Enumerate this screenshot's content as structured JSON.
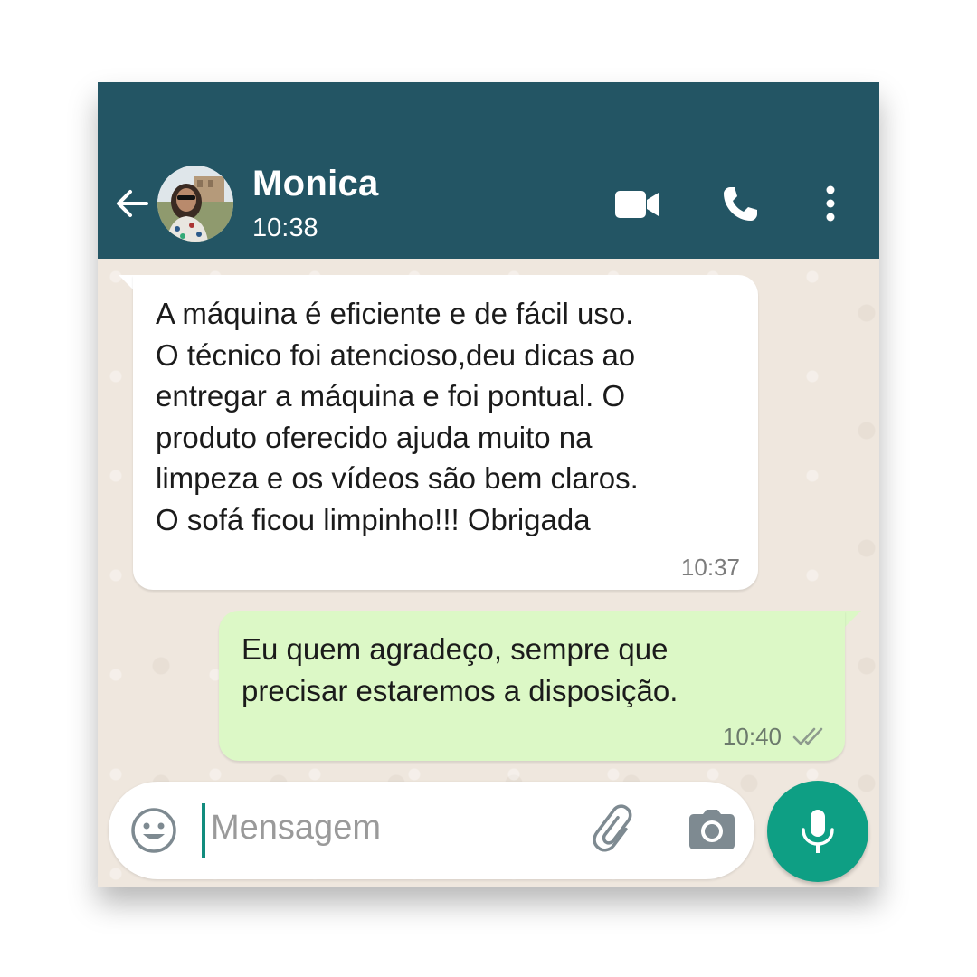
{
  "header": {
    "contact_name": "Monica",
    "last_seen": "10:38",
    "icons": [
      "back-arrow-icon",
      "video-call-icon",
      "phone-call-icon",
      "more-options-icon"
    ]
  },
  "messages": [
    {
      "direction": "incoming",
      "text": "A máquina é eficiente e de fácil uso.\nO técnico foi atencioso,deu dicas ao\nentregar a máquina e foi pontual.  O\nproduto oferecido ajuda muito na\nlimpeza e os vídeos são bem claros.\nO sofá ficou limpinho!!! Obrigada",
      "time": "10:37"
    },
    {
      "direction": "outgoing",
      "text": "Eu quem agradeço, sempre que\nprecisar estaremos a disposição.",
      "time": "10:40",
      "status": "read-double-check"
    }
  ],
  "composer": {
    "placeholder": "Mensagem",
    "icons": [
      "emoji-icon",
      "attach-icon",
      "camera-icon",
      "microphone-icon"
    ]
  },
  "colors": {
    "header": "#235564",
    "outgoing_bubble": "#dcf8c6",
    "incoming_bubble": "#ffffff",
    "chat_background": "#efe7de",
    "mic_button": "#0e9f84"
  }
}
